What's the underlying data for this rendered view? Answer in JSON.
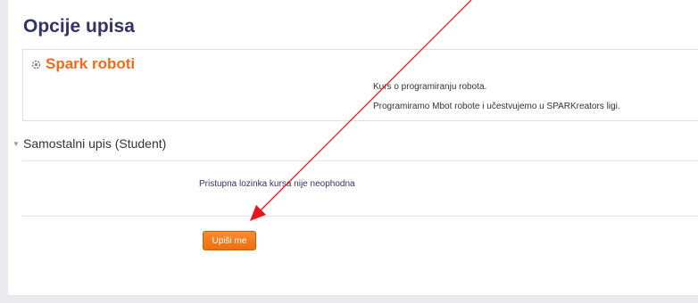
{
  "page": {
    "title": "Opcije upisa"
  },
  "course": {
    "name": "Spark roboti",
    "icon": "course-gear-icon",
    "description": [
      "Kurs o programiranju robota.",
      "Programiramo Mbot robote i učestvujemo u SPARKreators ligi."
    ]
  },
  "enrolment_section": {
    "title": "Samostalni upis (Student)",
    "toggle_icon": "triangle-down-icon",
    "no_key_message": "Pristupna lozinka kursa nije neophodna",
    "enrol_button_label": "Upiši me"
  },
  "colors": {
    "title": "#333366",
    "course_name": "#f26b1d",
    "button": "#f7801f",
    "annotation_arrow": "#e8141b"
  }
}
